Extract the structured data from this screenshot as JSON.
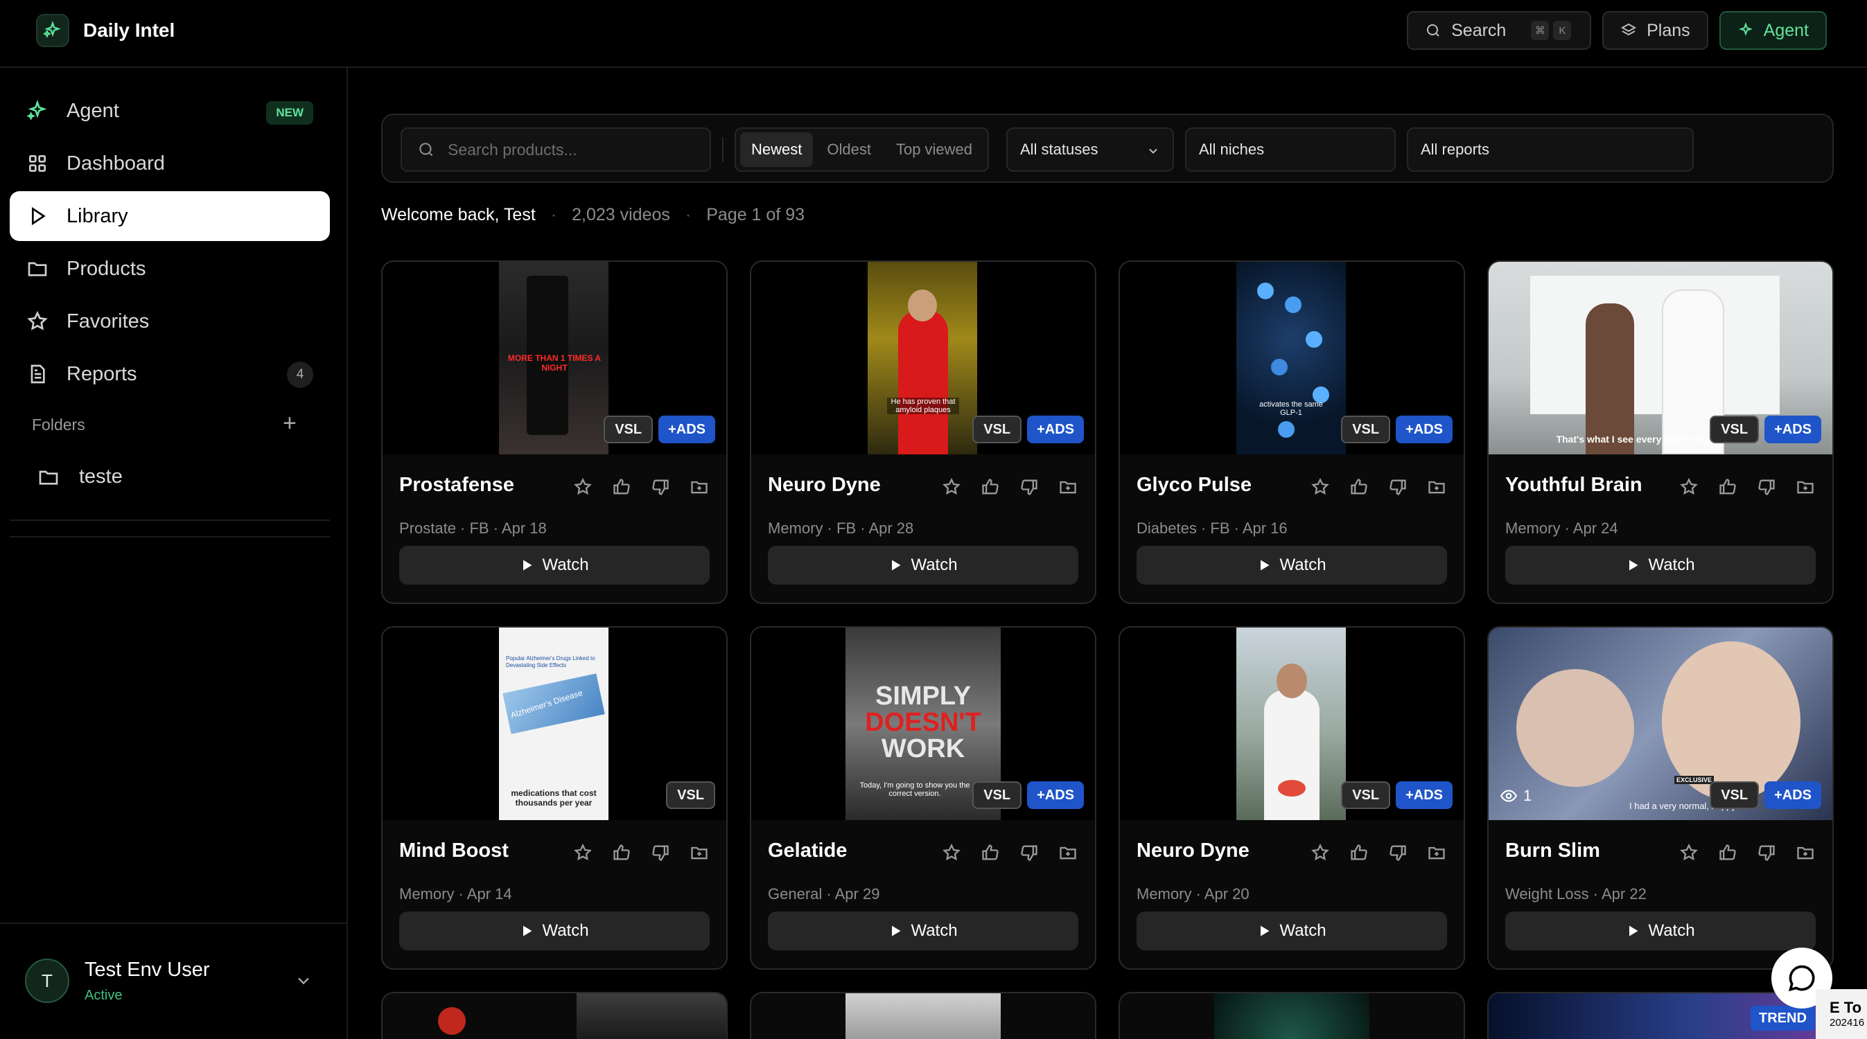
{
  "app": {
    "name": "Daily Intel"
  },
  "topbar": {
    "search_label": "Search",
    "search_kbd": [
      "⌘",
      "K"
    ],
    "plans_label": "Plans",
    "agent_label": "Agent"
  },
  "sidebar": {
    "items": [
      {
        "label": "Agent",
        "icon": "sparkle-icon",
        "badge": "NEW"
      },
      {
        "label": "Dashboard",
        "icon": "grid-icon"
      },
      {
        "label": "Library",
        "icon": "play-icon",
        "active": true
      },
      {
        "label": "Products",
        "icon": "folder-icon"
      },
      {
        "label": "Favorites",
        "icon": "star-icon"
      },
      {
        "label": "Reports",
        "icon": "document-icon",
        "count": "4"
      }
    ],
    "folders_label": "Folders",
    "folders": [
      {
        "label": "teste",
        "icon": "folder-icon"
      }
    ],
    "user": {
      "initial": "T",
      "name": "Test Env User",
      "status": "Active"
    }
  },
  "filters": {
    "search_placeholder": "Search products...",
    "sort_options": [
      "Newest",
      "Oldest",
      "Top viewed"
    ],
    "sort_active": "Newest",
    "status_select": "All statuses",
    "niche_select": "All niches",
    "report_select": "All reports"
  },
  "summary": {
    "welcome": "Welcome back, Test",
    "videos": "2,023 videos",
    "page": "Page 1 of 93"
  },
  "watch_label": "Watch",
  "cards": [
    {
      "title": "Prostafense",
      "meta": "Prostate · FB · Apr 18",
      "tags": [
        "VSL",
        "+ADS"
      ]
    },
    {
      "title": "Neuro Dyne",
      "meta": "Memory · FB · Apr 28",
      "tags": [
        "VSL",
        "+ADS"
      ]
    },
    {
      "title": "Glyco Pulse",
      "meta": "Diabetes · FB · Apr 16",
      "tags": [
        "VSL",
        "+ADS"
      ]
    },
    {
      "title": "Youthful Brain",
      "meta": "Memory · Apr 24",
      "tags": [
        "VSL",
        "+ADS"
      ]
    },
    {
      "title": "Mind Boost",
      "meta": "Memory · Apr 14",
      "tags": [
        "VSL"
      ]
    },
    {
      "title": "Gelatide",
      "meta": "General · Apr 29",
      "tags": [
        "VSL",
        "+ADS"
      ]
    },
    {
      "title": "Neuro Dyne",
      "meta": "Memory · Apr 20",
      "tags": [
        "VSL",
        "+ADS"
      ]
    },
    {
      "title": "Burn Slim",
      "meta": "Weight Loss · Apr 22",
      "tags": [
        "VSL",
        "+ADS"
      ],
      "views": "1"
    }
  ],
  "thumb_captions": {
    "prostafense": "MORE THAN 1 TIMES A NIGHT",
    "neuro1": "He has proven that amyloid plaques",
    "glyco": "activates the same GLP-1",
    "youthful": "That's what I see every day in re...",
    "mindboost_head": "Popular Alzheimer's Drugs Linked to Devastating Side Effects",
    "mindboost_caption": "Alzheimer's Disease",
    "mindboost_footer": "medications that cost thousands per year",
    "gelatide_1": "SIMPLY",
    "gelatide_2": "DOESN'T",
    "gelatide_3": "WORK",
    "gelatide_sub": "Today, I'm going to show you the correct version.",
    "burnslim": "I had a very normal, happy",
    "burnslim_tag": "EXCLUSIVE"
  },
  "trend_badge": "TREND",
  "corner_box": {
    "line1": "E To",
    "line2": "202416"
  },
  "colors": {
    "accent_green": "#5fe39a",
    "ads_blue": "#1f55c9",
    "background": "#000000"
  }
}
